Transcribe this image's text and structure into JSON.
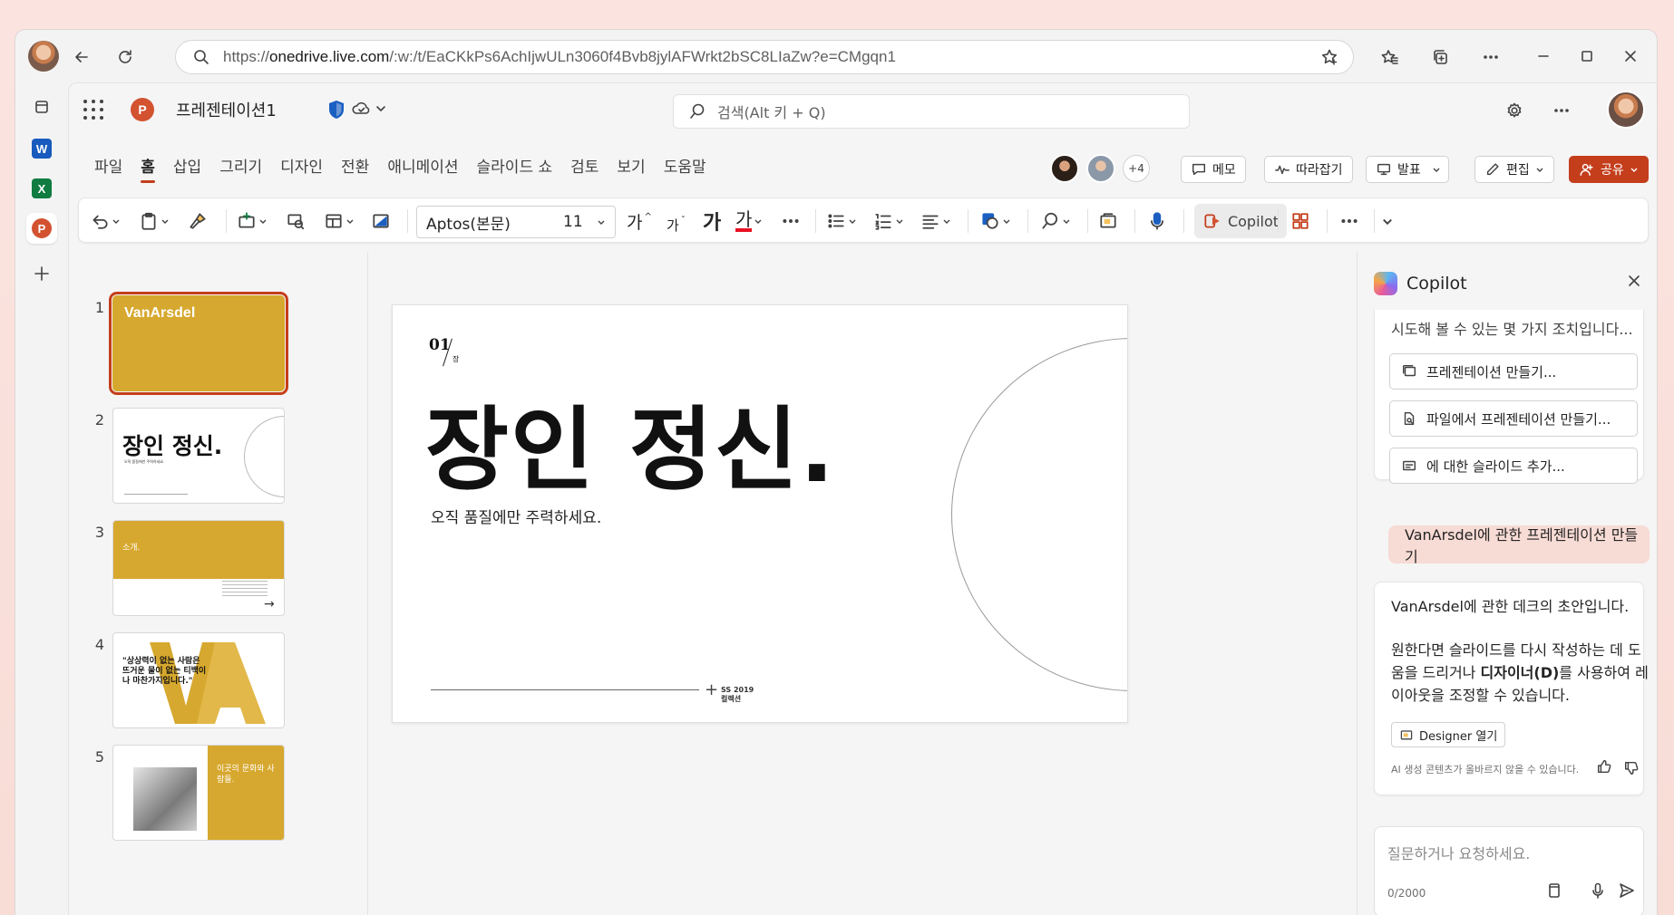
{
  "browser": {
    "url_prefix": "https://",
    "url_host": "onedrive.live.com",
    "url_path": "/:w:/t/EaCKkPs6AchIjwULn3060f4Bvb8jylAFWrkt2bSC8LIaZw?e=CMgqn1"
  },
  "app": {
    "document_title": "프레젠테이션1",
    "search_placeholder": "검색(Alt 키 + Q)"
  },
  "ribbon": {
    "tabs": [
      "파일",
      "홈",
      "삽입",
      "그리기",
      "디자인",
      "전환",
      "애니메이션",
      "슬라이드 쇼",
      "검토",
      "보기",
      "도움말"
    ],
    "active_tab": "홈",
    "collaborators_extra": "+4",
    "comment_label": "메모",
    "catchup_label": "따라잡기",
    "present_label": "발표",
    "edit_label": "편집",
    "share_label": "공유",
    "font_name": "Aptos(본문)",
    "font_size": "11",
    "grow_font": "가",
    "shrink_font": "가",
    "bold_label": "가",
    "font_color_label": "가",
    "copilot_label": "Copilot",
    "font_color": "#e81123"
  },
  "thumbnails": [
    {
      "num": "1",
      "brand": "VanArsdel"
    },
    {
      "num": "2",
      "title": "장인 정신.",
      "sub": "오직 품질에만 주력하세요."
    },
    {
      "num": "3",
      "title": "소개."
    },
    {
      "num": "4",
      "quote": "\"상상력이 없는 사람은 뜨거운 물이 없는 티백이나 마찬가지입니다.\""
    },
    {
      "num": "5",
      "title": "이곳의 문화와 사람들."
    }
  ],
  "slide": {
    "number": "01",
    "chapter": "장",
    "title": "장인 정신.",
    "subtitle": "오직 품질에만 주력하세요.",
    "footer_line1": "SS 2019",
    "footer_line2": "컬렉션"
  },
  "copilot": {
    "title": "Copilot",
    "truncated_line": "시도해 볼 수 있는 몇 가지 조치입니다...",
    "suggestions": [
      "프레젠테이션 만들기...",
      "파일에서 프레젠테이션 만들기...",
      "에 대한 슬라이드 추가..."
    ],
    "user_message": "VanArsdel에 관한 프레젠테이션 만들기",
    "response_line1": "VanArsdel에 관한 데크의 초안입니다.",
    "response_line2a": "원한다면 슬라이드를 다시 작성하는 데 도움을 드리거나 ",
    "response_bold": "디자이너(D)",
    "response_line2b": "를 사용하여 레이아웃을 조정할 수 있습니다.",
    "designer_button": "Designer 열기",
    "ai_note": "AI 생성 콘텐츠가 올바르지 않을 수 있습니다.",
    "input_placeholder": "질문하거나 요청하세요.",
    "char_count": "0/2000"
  },
  "colors": {
    "accent": "#c43e1c",
    "thumb_gold": "#d7a82f",
    "powerpoint": "#d35230",
    "word": "#185abd",
    "excel": "#107c41"
  }
}
